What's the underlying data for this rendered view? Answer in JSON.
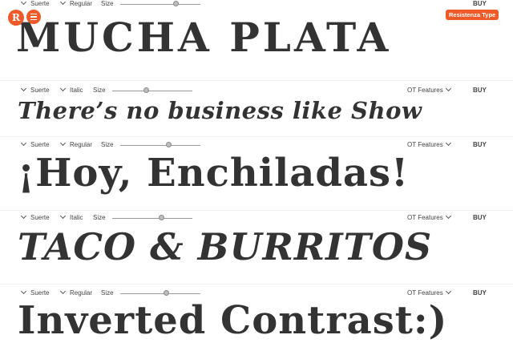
{
  "brand": {
    "logo_glyph": "R",
    "badge": "Resistenza Type",
    "accent": "#ef5a28"
  },
  "sections": [
    {
      "family": "Suerte",
      "style": "Regular",
      "size_label": "Size",
      "size_level": 0.6,
      "features": "",
      "buy": "BUY",
      "specimen": "MUCHA PLATA"
    },
    {
      "family": "Suerte",
      "style": "Italic",
      "size_label": "Size",
      "size_level": 0.35,
      "features": "OT Features",
      "buy": "BUY",
      "specimen": "There’s no business like Show"
    },
    {
      "family": "Suerte",
      "style": "Regular",
      "size_label": "Size",
      "size_level": 0.65,
      "features": "OT Features",
      "buy": "BUY",
      "specimen": "¡Hoy, Enchiladas!"
    },
    {
      "family": "Suerte",
      "style": "Italic",
      "size_label": "Size",
      "size_level": 0.6,
      "features": "OT Features",
      "buy": "BUY",
      "specimen": "TACO & BURRITOS"
    },
    {
      "family": "Suerte",
      "style": "Regular",
      "size_label": "Size",
      "size_level": 0.65,
      "features": "OT Features",
      "buy": "BUY",
      "specimen": "Inverted Contrast:)"
    }
  ]
}
